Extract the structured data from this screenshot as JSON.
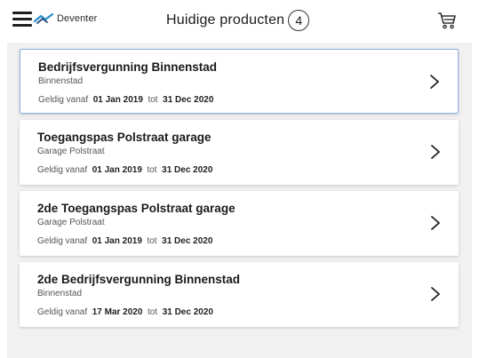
{
  "header": {
    "logo_text": "Deventer",
    "title": "Huidige producten",
    "count": "4"
  },
  "products": [
    {
      "title": "Bedrijfsvergunning Binnenstad",
      "location": "Binnenstad",
      "valid_from_label": "Geldig vanaf",
      "valid_from": "01 Jan 2019",
      "until_label": "tot",
      "valid_until": "31 Dec 2020"
    },
    {
      "title": "Toegangspas Polstraat garage",
      "location": "Garage Polstraat",
      "valid_from_label": "Geldig vanaf",
      "valid_from": "01 Jan 2019",
      "until_label": "tot",
      "valid_until": "31 Dec 2020"
    },
    {
      "title": "2de Toegangspas Polstraat garage",
      "location": "Garage Polstraat",
      "valid_from_label": "Geldig vanaf",
      "valid_from": "01 Jan 2019",
      "until_label": "tot",
      "valid_until": "31 Dec 2020"
    },
    {
      "title": "2de Bedrijfsvergunning Binnenstad",
      "location": "Binnenstad",
      "valid_from_label": "Geldig vanaf",
      "valid_from": "17 Mar 2020",
      "until_label": "tot",
      "valid_until": "31 Dec 2020"
    }
  ],
  "icons": {
    "menu": "hamburger-menu-icon",
    "logo": "deventer-logo-icon",
    "cart": "shopping-cart-icon",
    "chevron": "chevron-right-icon"
  },
  "colors": {
    "selected_border": "#8fb3e6",
    "background": "#f1f1f1",
    "logo_accent": "#2a8fc9"
  }
}
